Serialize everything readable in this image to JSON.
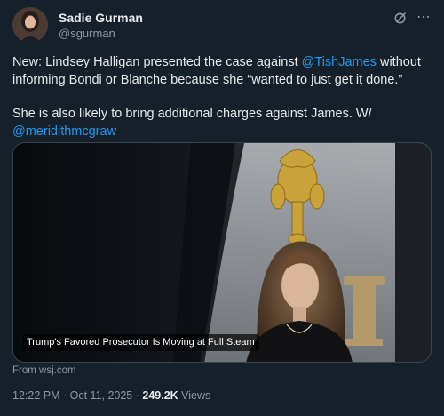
{
  "author": {
    "display_name": "Sadie Gurman",
    "handle": "@sgurman"
  },
  "icons": {
    "grok": "grok-icon",
    "more": "more-icon"
  },
  "tweet": {
    "line1_prefix": "New: Lindsey Halligan presented the case against ",
    "line1_mention": "@TishJames",
    "line1_suffix": " without informing Bondi or Blanche because she “wanted to just get it done.”",
    "line2": "She is also likely to bring additional charges against James. W/ ",
    "line2_mention": "@meridithmcgraw"
  },
  "card": {
    "headline": "Trump's Favored Prosecutor Is Moving at Full Steam",
    "source": "From wsj.com"
  },
  "meta": {
    "timestamp": "12:22 PM · Oct 11, 2025",
    "separator": " · ",
    "views_count": "249.2K",
    "views_label": " Views"
  },
  "colors": {
    "background": "#15202b",
    "mention": "#1d9bf0",
    "secondary_text": "#8b98a5"
  }
}
